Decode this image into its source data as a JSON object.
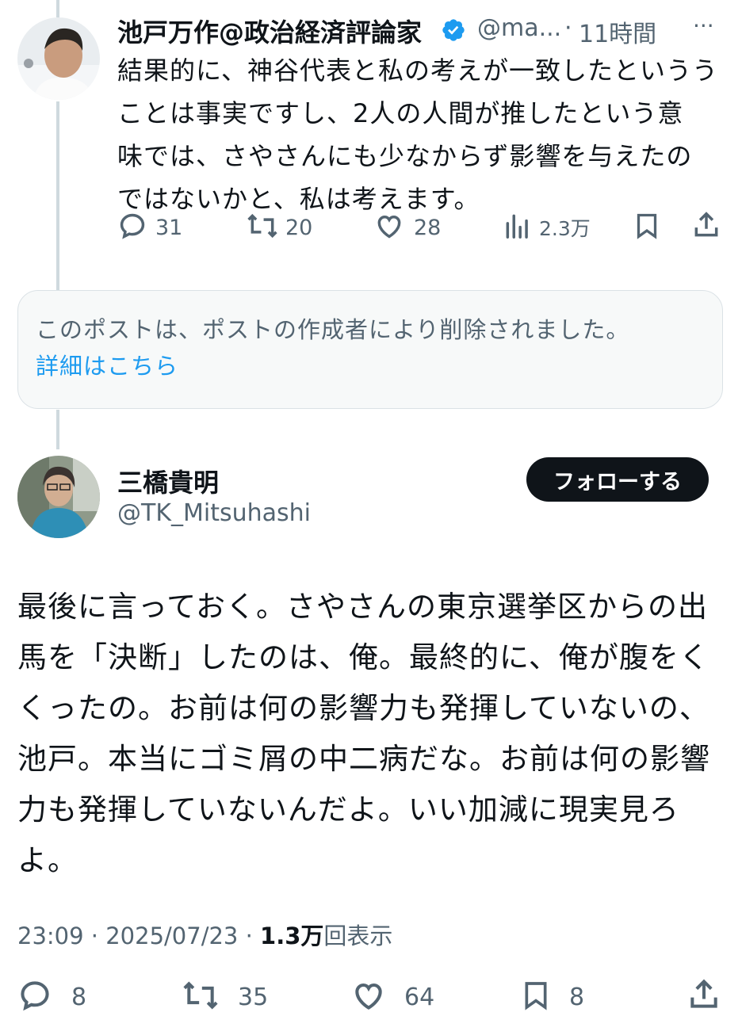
{
  "reply": {
    "author_name": "池戸万作@政治経済評論家",
    "handle": "@ma...",
    "separator": "·",
    "time": "11時間",
    "more": "···",
    "text_lines": [
      "結果的に、神谷代表と私の考えが一致したというう",
      "ことは事実ですし、2人の人間が推したという意",
      "味では、さやさんにも少なからず影響を与えたの",
      "ではないかと、私は考えます。"
    ],
    "stats": {
      "replies": "31",
      "reposts": "20",
      "likes": "28",
      "views": "2.3万"
    }
  },
  "deleted_notice": {
    "text": "このポストは、ポストの作成者により削除されました。",
    "link": "詳細はこちら"
  },
  "main": {
    "author_name": "三橋貴明",
    "handle": "@TK_Mitsuhashi",
    "follow_label": "フォローする",
    "text_lines": [
      "最後に言っておく。さやさんの東京選挙区からの出",
      "馬を「決断」したのは、俺。最終的に、俺が腹をく",
      "くったの。お前は何の影響力も発揮していないの、",
      "池戸。本当にゴミ屑の中二病だな。お前は何の影響",
      "力も発揮していないんだよ。いい加減に現実見ろ",
      "よ。"
    ],
    "meta": {
      "time": "23:09",
      "date": "2025/07/23",
      "dot": "·",
      "views": "1.3万",
      "views_suffix": "回表示"
    },
    "stats": {
      "replies": "8",
      "reposts": "35",
      "likes": "64",
      "bookmarks": "8"
    }
  },
  "colors": {
    "verified_badge": "#1d9bf0",
    "link": "#1d9bf0",
    "text": "#0f1419",
    "secondary": "#536471"
  },
  "icons": [
    "verified-badge-icon",
    "reply-icon",
    "repost-icon",
    "like-icon",
    "views-icon",
    "bookmark-icon",
    "share-icon"
  ]
}
